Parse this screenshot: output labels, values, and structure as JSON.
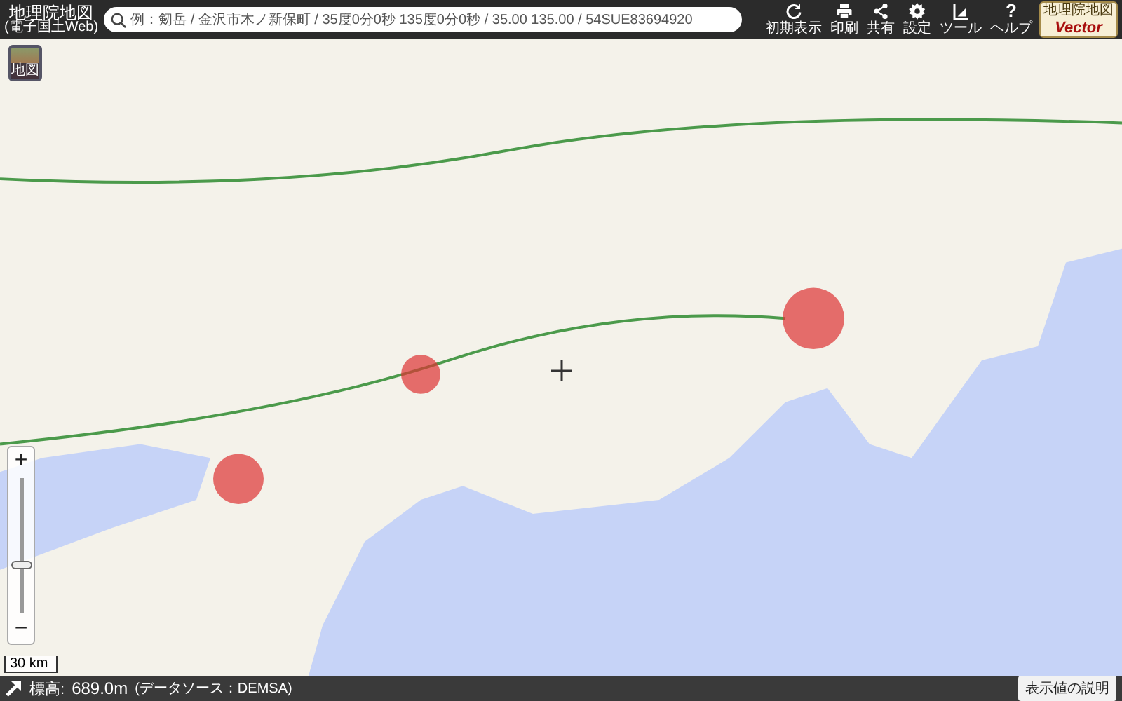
{
  "header": {
    "logo_title": "地理院地図",
    "logo_subtitle": "(電子国土Web)",
    "search": {
      "placeholder": "例：剱岳 / 金沢市木ノ新保町 / 35度0分0秒 135度0分0秒 / 35.00 135.00 / 54SUE83694920"
    },
    "toolbar": [
      {
        "kind": "reset",
        "label": "初期表示"
      },
      {
        "kind": "print",
        "label": "印刷"
      },
      {
        "kind": "share",
        "label": "共有"
      },
      {
        "kind": "settings",
        "label": "設定"
      },
      {
        "kind": "tool",
        "label": "ツール"
      },
      {
        "kind": "help",
        "glyph": "?",
        "label": "ヘルプ"
      }
    ],
    "vector_badge": {
      "top": "地理院地図",
      "bottom": "Vector"
    }
  },
  "map": {
    "base_map_button": {
      "label": "地図"
    },
    "zoom": {
      "plus": "+",
      "minus": "−",
      "level": 0.35
    },
    "scale": "30 km"
  },
  "footer": {
    "elevation_label": "標高:",
    "elevation_value": "689.0m",
    "source": "(データソース：DEMSA)",
    "explain_button": "表示値の説明"
  }
}
